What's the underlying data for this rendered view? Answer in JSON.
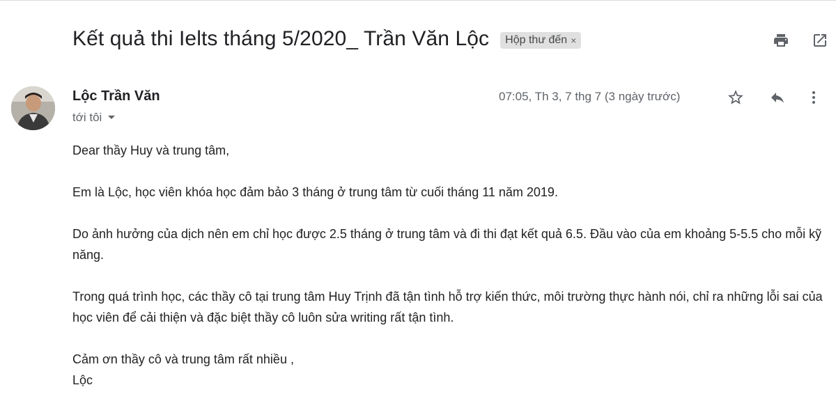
{
  "email": {
    "subject": "Kết quả thi Ielts tháng 5/2020_ Trần Văn Lộc",
    "label": "Hộp thư đến",
    "label_close": "×",
    "sender": "Lộc Trần Văn",
    "recipient": "tới tôi",
    "timestamp": "07:05, Th 3, 7 thg 7 (3 ngày trước)",
    "body": {
      "greeting": "Dear thầy Huy và trung tâm,",
      "p1": "Em là Lộc, học viên khóa học đảm bảo 3 tháng ở trung tâm từ cuối tháng 11 năm 2019.",
      "p2": "Do ảnh hưởng của dịch nên em chỉ học được 2.5 tháng ở trung tâm và đi thi đạt kết quả 6.5. Đầu vào của em khoảng 5-5.5 cho mỗi kỹ năng.",
      "p3": "Trong quá trình học, các thầy cô tại trung tâm Huy Trịnh đã tận tình hỗ trợ kiến thức, môi trường thực hành nói, chỉ ra những lỗi sai của học viên để cải thiện và đặc biệt thầy cô luôn sửa writing rất tận tình.",
      "closing": "Cảm ơn thầy cô và trung tâm rất nhiều ,",
      "signature": "Lộc"
    }
  },
  "icons": {
    "print": "print-icon",
    "open_new_window": "open-in-new-window-icon",
    "star": "star-icon",
    "reply": "reply-icon",
    "more": "more-vertical-icon",
    "dropdown": "caret-down-icon"
  },
  "colors": {
    "text": "#222222",
    "secondary_text": "#5f6368",
    "chip_bg": "#e0e0e0",
    "icon": "#5f6368"
  }
}
